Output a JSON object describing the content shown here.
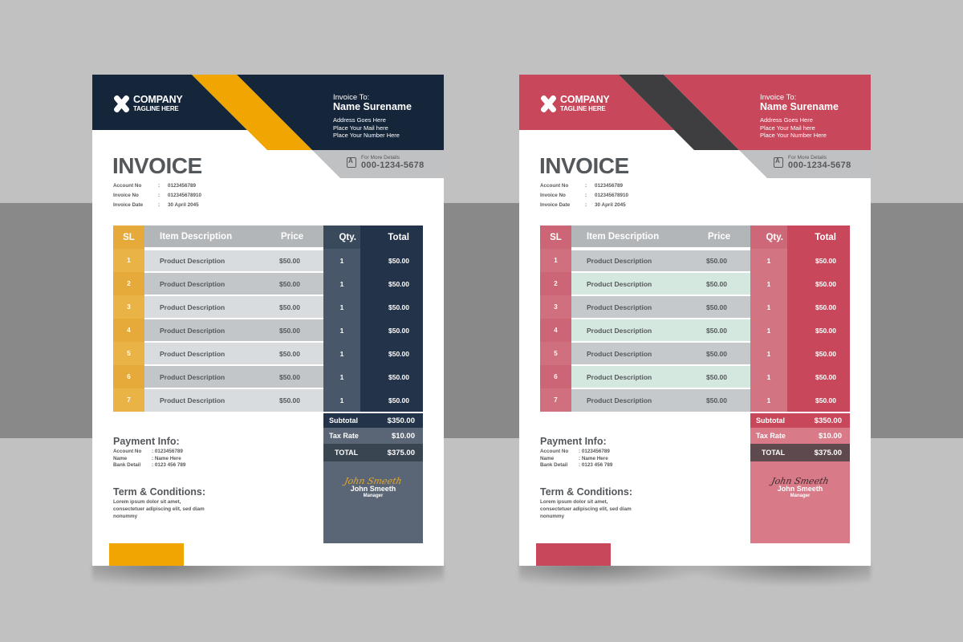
{
  "invoices": [
    {
      "theme": "navy-yellow",
      "colors": {
        "header": "#15263b",
        "stripe": "#f0a500",
        "contact_bar": "#bfc1c3",
        "sl_col": "#e5aa3a",
        "sl_col_alt": "#eab346",
        "row_a": "#d9dcde",
        "row_b": "#c3c6c9",
        "header_grey": "#b3b6b9",
        "qty_col": "#485769",
        "qty_header": "#394a5d",
        "total_col": "#23334a",
        "subtotal_bg": "#23334a",
        "tax_bg": "#5a6676",
        "total_bg": "#394550",
        "sig_bg": "#5a6676",
        "sig_script": "#e6a92c",
        "foot_block": "#f0a500"
      },
      "header": {
        "company": "COMPANY",
        "tagline": "TAGLINE HERE",
        "invoice_to_label": "Invoice To:",
        "name": "Name Surename",
        "address": "Address Goes Here",
        "mail": "Place Your Mail here",
        "number": "Place Your Number Here",
        "contact_label": "For More Details",
        "contact_number": "000-1234-5678"
      },
      "title": "INVOICE",
      "meta": [
        {
          "label": "Account No",
          "sep": ":",
          "value": "0123456789"
        },
        {
          "label": "Invoice No",
          "sep": ":",
          "value": "012345678910"
        },
        {
          "label": "Invoice Date",
          "sep": ":",
          "value": "30 April 2045"
        }
      ],
      "table": {
        "columns": [
          "SL",
          "Item Description",
          "Price",
          "Qty.",
          "Total"
        ],
        "rows": [
          {
            "sl": "1",
            "desc": "Product Description",
            "price": "$50.00",
            "qty": "1",
            "total": "$50.00"
          },
          {
            "sl": "2",
            "desc": "Product Description",
            "price": "$50.00",
            "qty": "1",
            "total": "$50.00"
          },
          {
            "sl": "3",
            "desc": "Product Description",
            "price": "$50.00",
            "qty": "1",
            "total": "$50.00"
          },
          {
            "sl": "4",
            "desc": "Product Description",
            "price": "$50.00",
            "qty": "1",
            "total": "$50.00"
          },
          {
            "sl": "5",
            "desc": "Product Description",
            "price": "$50.00",
            "qty": "1",
            "total": "$50.00"
          },
          {
            "sl": "6",
            "desc": "Product Description",
            "price": "$50.00",
            "qty": "1",
            "total": "$50.00"
          },
          {
            "sl": "7",
            "desc": "Product Description",
            "price": "$50.00",
            "qty": "1",
            "total": "$50.00"
          }
        ]
      },
      "summary": {
        "subtotal_label": "Subtotal",
        "subtotal": "$350.00",
        "tax_label": "Tax Rate",
        "tax": "$10.00",
        "total_label": "TOTAL",
        "total": "$375.00"
      },
      "signature": {
        "script": "John Smeeth",
        "name": "John Smeeth",
        "role": "Manager"
      },
      "payment": {
        "heading": "Payment Info:",
        "rows": [
          {
            "label": "Account No",
            "value": ": 0123456789"
          },
          {
            "label": "Name",
            "value": ": Name Here"
          },
          {
            "label": "Bank Detail",
            "value": ": 0123 456 789"
          }
        ]
      },
      "terms": {
        "heading": "Term & Conditions:",
        "text": "Lorem ipsum dolor sit amet, consectetuer adipiscing elit, sed diam nonummy"
      }
    },
    {
      "theme": "red-charcoal",
      "colors": {
        "header": "#c9475a",
        "stripe": "#3e3e40",
        "contact_bar": "#bfc1c3",
        "sl_col": "#cc6575",
        "sl_col_alt": "#d06f7e",
        "row_a": "#c6c9cb",
        "row_b": "#d5e8df",
        "header_grey": "#b3b6b9",
        "qty_col": "#d27482",
        "qty_header": "#cd6878",
        "total_col": "#c9475a",
        "subtotal_bg": "#c9475a",
        "tax_bg": "#d87a88",
        "total_bg": "#5e4a4e",
        "sig_bg": "#d87a88",
        "sig_script": "#3b2a2e",
        "foot_block": "#c9475a"
      },
      "header": {
        "company": "COMPANY",
        "tagline": "TAGLINE HERE",
        "invoice_to_label": "Invoice To:",
        "name": "Name Surename",
        "address": "Address Goes Here",
        "mail": "Place Your Mail here",
        "number": "Place Your Number Here",
        "contact_label": "For More Details",
        "contact_number": "000-1234-5678"
      },
      "title": "INVOICE",
      "meta": [
        {
          "label": "Account No",
          "sep": ":",
          "value": "0123456789"
        },
        {
          "label": "Invoice No",
          "sep": ":",
          "value": "012345678910"
        },
        {
          "label": "Invoice Date",
          "sep": ":",
          "value": "30 April 2045"
        }
      ],
      "table": {
        "columns": [
          "SL",
          "Item Description",
          "Price",
          "Qty.",
          "Total"
        ],
        "rows": [
          {
            "sl": "1",
            "desc": "Product Description",
            "price": "$50.00",
            "qty": "1",
            "total": "$50.00"
          },
          {
            "sl": "2",
            "desc": "Product Description",
            "price": "$50.00",
            "qty": "1",
            "total": "$50.00"
          },
          {
            "sl": "3",
            "desc": "Product Description",
            "price": "$50.00",
            "qty": "1",
            "total": "$50.00"
          },
          {
            "sl": "4",
            "desc": "Product Description",
            "price": "$50.00",
            "qty": "1",
            "total": "$50.00"
          },
          {
            "sl": "5",
            "desc": "Product Description",
            "price": "$50.00",
            "qty": "1",
            "total": "$50.00"
          },
          {
            "sl": "6",
            "desc": "Product Description",
            "price": "$50.00",
            "qty": "1",
            "total": "$50.00"
          },
          {
            "sl": "7",
            "desc": "Product Description",
            "price": "$50.00",
            "qty": "1",
            "total": "$50.00"
          }
        ]
      },
      "summary": {
        "subtotal_label": "Subtotal",
        "subtotal": "$350.00",
        "tax_label": "Tax Rate",
        "tax": "$10.00",
        "total_label": "TOTAL",
        "total": "$375.00"
      },
      "signature": {
        "script": "John Smeeth",
        "name": "John Smeeth",
        "role": "Manager"
      },
      "payment": {
        "heading": "Payment Info:",
        "rows": [
          {
            "label": "Account No",
            "value": ": 0123456789"
          },
          {
            "label": "Name",
            "value": ": Name Here"
          },
          {
            "label": "Bank Detail",
            "value": ": 0123 456 789"
          }
        ]
      },
      "terms": {
        "heading": "Term & Conditions:",
        "text": "Lorem ipsum dolor sit amet, consectetuer adipiscing elit, sed diam nonummy"
      }
    }
  ],
  "background": {
    "base": "#c1c1c1",
    "band": "#898989"
  }
}
